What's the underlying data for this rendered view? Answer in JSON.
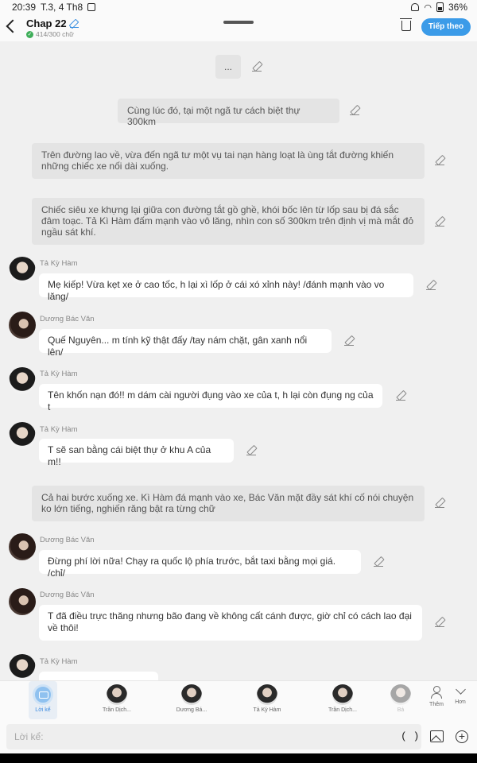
{
  "status_bar": {
    "time": "20:39",
    "date": "T.3, 4 Th8",
    "battery": "36%"
  },
  "header": {
    "title": "Chap 22",
    "word_count": "414/300 chữ",
    "next_label": "Tiếp theo"
  },
  "messages": [
    {
      "kind": "narration",
      "text": "..."
    },
    {
      "kind": "narration",
      "text": "Cùng lúc đó, tại một ngã tư cách biệt thự 300km"
    },
    {
      "kind": "narration",
      "text": "Trên đường lao về, vừa đến ngã tư một vụ tai nạn hàng loạt là ùng tắt đường khiến những chiếc xe nối dài xuống."
    },
    {
      "kind": "narration",
      "text": "Chiếc siêu xe khựng lại giữa con đường tắt gồ ghề, khói bốc lên từ lốp sau bị đá sắc đâm toạc. Tả Kì Hàm đấm mạnh vào vô lăng, nhìn con số 300km trên định vị mà mắt đỏ ngầu sát khí."
    },
    {
      "kind": "chat",
      "speaker": "Tả Kỳ Hàm",
      "text": "Mẹ kiếp! Vừa kẹt xe ở cao tốc, h lại xì lốp ở cái xó xỉnh này! /đánh mạnh vào vo lăng/"
    },
    {
      "kind": "chat",
      "speaker": "Dương Bác Văn",
      "text": "Quế Nguyên... m tính kỹ thật đấy /tay nám chặt, gân xanh nổi lên/"
    },
    {
      "kind": "chat",
      "speaker": "Tả Kỳ Hàm",
      "text": "Tên khốn nạn đó!! m dám cài người đụng vào xe của t, h lại còn đụng ng của t"
    },
    {
      "kind": "chat",
      "speaker": "Tả Kỳ Hàm",
      "text": "T sẽ san bằng cái biệt thự ở khu A của m!!"
    },
    {
      "kind": "narration",
      "text": "Cả hai bước xuống xe. Kì Hàm đá mạnh vào xe, Bác Văn mặt đầy sát khí cố nói chuyện ko lớn tiếng, nghiến răng bật ra từng chữ"
    },
    {
      "kind": "chat",
      "speaker": "Dương Bác Văn",
      "text": "Đừng phí lời nữa! Chạy ra quốc lộ phía trước, bắt taxi bằng mọi giá. /chỉ/"
    },
    {
      "kind": "chat",
      "speaker": "Dương Bác Văn",
      "text": "T đã điều trực thăng nhưng bão đang về không cất cánh được, giờ chỉ có cách lao đại về thôi!"
    },
    {
      "kind": "chat",
      "speaker": "Tả Kỳ Hàm",
      "text": ""
    }
  ],
  "characters": [
    {
      "label": "Lời kể",
      "selected": true
    },
    {
      "label": "Trần Dịch..."
    },
    {
      "label": "Dương Bá..."
    },
    {
      "label": "Tả Kỳ Hàm"
    },
    {
      "label": "Trần Dịch..."
    },
    {
      "label": "Bá"
    }
  ],
  "char_actions": {
    "add_label": "Thêm",
    "more_label": "Hơn"
  },
  "input": {
    "placeholder": "Lời kể:",
    "paren_button": "( )"
  }
}
